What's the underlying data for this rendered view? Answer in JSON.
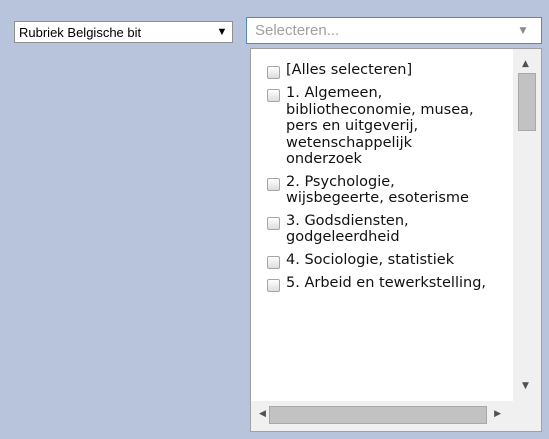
{
  "filter_select": {
    "value": "Rubriek Belgische bit",
    "arrow": "▼"
  },
  "multi_select": {
    "placeholder": "Selecteren...",
    "arrow": "▼"
  },
  "dropdown": {
    "options": [
      {
        "label": "[Alles selecteren]",
        "checked": false
      },
      {
        "label": "1. Algemeen, bibliotheconomie, musea, pers en uitgeverij, wetenschappelijk onderzoek",
        "checked": false
      },
      {
        "label": "2. Psychologie, wijsbegeerte, esoterisme",
        "checked": false
      },
      {
        "label": "3. Godsdiensten, godgeleerdheid",
        "checked": false
      },
      {
        "label": "4. Sociologie, statistiek",
        "checked": false
      },
      {
        "label": "5. Arbeid en tewerkstelling,",
        "checked": false
      }
    ],
    "scroll_icons": {
      "up": "▲",
      "down": "▼",
      "left": "◀",
      "right": "▶"
    }
  }
}
